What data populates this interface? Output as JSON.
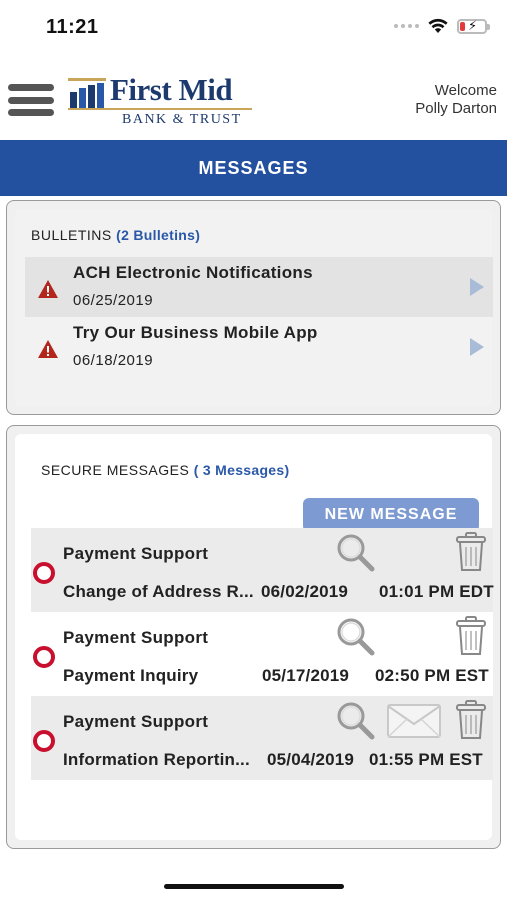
{
  "status_bar": {
    "time": "11:21"
  },
  "header": {
    "logo_name": "First Mid",
    "logo_sub": "BANK & TRUST",
    "welcome_line": "Welcome",
    "user_name": "Polly Darton"
  },
  "page_title": "MESSAGES",
  "bulletins": {
    "heading": "BULLETINS",
    "count_label": "(2 Bulletins)",
    "items": [
      {
        "title": "ACH Electronic Notifications",
        "date": "06/25/2019"
      },
      {
        "title": "Try Our Business Mobile App",
        "date": "06/18/2019"
      }
    ]
  },
  "secure_messages": {
    "heading": "SECURE MESSAGES",
    "count_label": "( 3 Messages)",
    "new_message_label": "NEW MESSAGE",
    "items": [
      {
        "sender": "Payment Support",
        "subject": "Change of Address R...",
        "date": "06/02/2019",
        "time": "01:01 PM EDT"
      },
      {
        "sender": "Payment Support",
        "subject": "Payment Inquiry",
        "date": "05/17/2019",
        "time": "02:50 PM EST"
      },
      {
        "sender": "Payment Support",
        "subject": "Information Reportin...",
        "date": "05/04/2019",
        "time": "01:55 PM EST"
      }
    ]
  },
  "colors": {
    "brand_blue": "#23509f",
    "logo_navy": "#1d3a6e",
    "logo_gold": "#c9a55a",
    "button_blue": "#7d9bd2",
    "unread_red": "#c8102e",
    "warning_red": "#b3261e"
  },
  "icons": {
    "menu": "hamburger-menu-icon",
    "warning": "warning-triangle-icon",
    "chevron": "chevron-right-icon",
    "search": "magnifier-icon",
    "trash": "trash-icon",
    "envelope": "envelope-icon",
    "unread": "unread-ring-icon"
  }
}
